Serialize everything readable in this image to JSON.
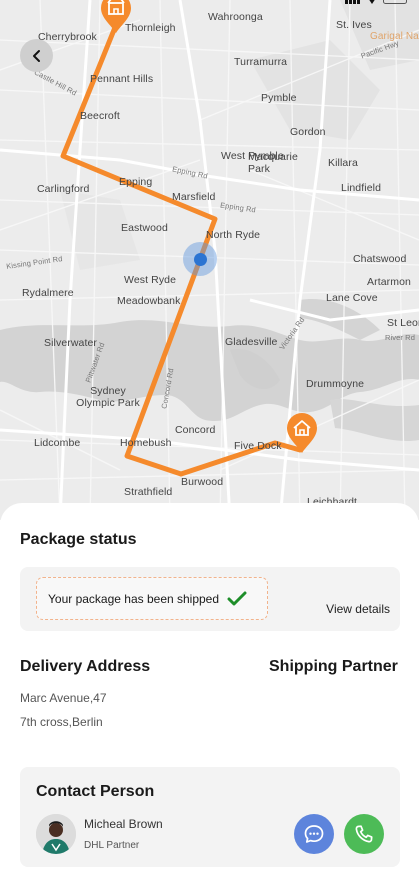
{
  "map": {
    "labels": [
      {
        "text": "Wahroonga"
      },
      {
        "text": "Cherrybrook"
      },
      {
        "text": "Thornleigh"
      },
      {
        "text": "St. Ives"
      },
      {
        "text": "Garigal National"
      },
      {
        "text": "Turramurra"
      },
      {
        "text": "Pennant Hills"
      },
      {
        "text": "Pymble"
      },
      {
        "text": "Beecroft"
      },
      {
        "text": "Gordon"
      },
      {
        "text": "West Pymble"
      },
      {
        "text": "Killara"
      },
      {
        "text": "Epping"
      },
      {
        "text": "Macquarie Park"
      },
      {
        "text": "Carlingford"
      },
      {
        "text": "Marsfield"
      },
      {
        "text": "Lindfield"
      },
      {
        "text": "Eastwood"
      },
      {
        "text": "North Ryde"
      },
      {
        "text": "Chatswood"
      },
      {
        "text": "West Ryde"
      },
      {
        "text": "Artarmon"
      },
      {
        "text": "Rydalmere"
      },
      {
        "text": "Meadowbank"
      },
      {
        "text": "Lane Cove"
      },
      {
        "text": "St Leonards"
      },
      {
        "text": "Gladesville"
      },
      {
        "text": "Silverwater"
      },
      {
        "text": "Sydney Olympic Park"
      },
      {
        "text": "Drummoyne"
      },
      {
        "text": "Lidcombe"
      },
      {
        "text": "Homebush"
      },
      {
        "text": "Concord"
      },
      {
        "text": "Five Dock"
      },
      {
        "text": "Burwood"
      },
      {
        "text": "Strathfield"
      },
      {
        "text": "Leichhardt"
      }
    ],
    "road_labels": [
      {
        "text": "Castle Hill Rd"
      },
      {
        "text": "Epping Rd"
      },
      {
        "text": "Epping Rd"
      },
      {
        "text": "Kissing Point Rd"
      },
      {
        "text": "Pittwater Rd"
      },
      {
        "text": "Victoria Rd"
      },
      {
        "text": "Concord Rd"
      },
      {
        "text": "River Rd"
      },
      {
        "text": "Pacific Hwy"
      }
    ],
    "route_color": "#f58a2c",
    "start_pin": {
      "icon": "store-icon"
    },
    "end_pin": {
      "icon": "home-icon"
    },
    "current_location_color": "#2b74d2"
  },
  "nav": {
    "back_icon": "chevron-left-icon"
  },
  "package_status": {
    "title": "Package status",
    "message": "Your package has been shipped",
    "check_color": "#1e8e2a",
    "view_details": "View details"
  },
  "delivery": {
    "title": "Delivery Address",
    "line1": "Marc Avenue,47",
    "line2": "7th cross,Berlin"
  },
  "shipping": {
    "title": "Shipping Partner"
  },
  "contact": {
    "title": "Contact Person",
    "name": "Micheal Brown",
    "role": "DHL Partner",
    "chat_icon": "chat-icon",
    "call_icon": "phone-icon",
    "chat_color": "#5d84dc",
    "call_color": "#4dbb57"
  }
}
